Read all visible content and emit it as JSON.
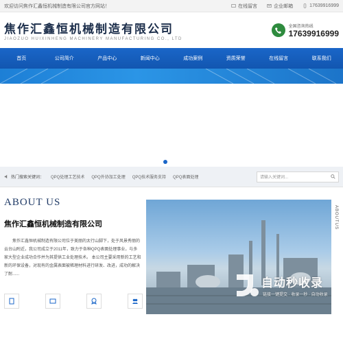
{
  "topbar": {
    "welcome": "欢迎访问焦作汇鑫恒机械制造有限公司官方网站！",
    "online_msg": "在线留言",
    "email": "企业邮箱",
    "phone": "17639916999"
  },
  "header": {
    "logo_cn": "焦作汇鑫恒机械制造有限公司",
    "logo_en": "JIAOZUO HUIXINHENG MACHINERY MANUFACTURING CO., LTD",
    "hotline_label": "全国咨询热线",
    "hotline_number": "17639916999"
  },
  "nav": {
    "items": [
      {
        "label": "首页"
      },
      {
        "label": "公司简介"
      },
      {
        "label": "产品中心"
      },
      {
        "label": "新闻中心"
      },
      {
        "label": "成功案例"
      },
      {
        "label": "资质荣誉"
      },
      {
        "label": "在线留言"
      },
      {
        "label": "联系我们"
      }
    ]
  },
  "search": {
    "hot_label": "热门搜索关键词：",
    "keywords": [
      "QPQ处理工艺技术",
      "QPQ外协加工处理",
      "QPQ技术服务支持",
      "QPQ表面处理"
    ],
    "placeholder": "请输入关键词..."
  },
  "about": {
    "title": "ABOUT US",
    "side_tab": "ABOUTUS",
    "company": "焦作汇鑫恒机械制造有限公司",
    "text": "焦作汇鑫恒机械制造有限公司位于美丽的太行山脚下，处于风景秀丽的云台山附近，我公司成立于2011年，致力于各种QPQ表面处理事业，与多家大型企业成功合作并为其提供工业处理技术。 本公司主要采用新的工艺和新的环保设备，对现有的金属表面被稀理材料进行研发、改进，成功的解决了耐......",
    "watermark_main": "自动秒收录",
    "watermark_sub": "链接一键提交 · 收录一秒 · 自动收录"
  },
  "colors": {
    "nav_blue": "#1a66c8",
    "phone_green": "#2e8b3e",
    "title_navy": "#1f3a66"
  }
}
